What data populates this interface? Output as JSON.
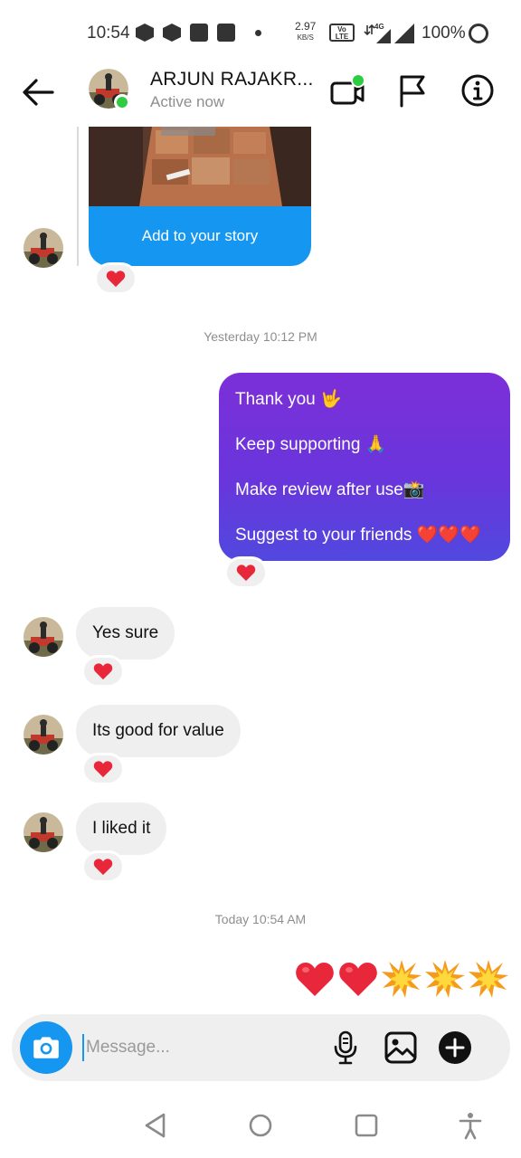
{
  "status_bar": {
    "time": "10:54",
    "net_speed": "2.97",
    "net_speed_unit": "KB/S",
    "volte_top": "Vo",
    "volte_bottom": "LTE",
    "network_type": "4G",
    "battery": "100%"
  },
  "header": {
    "contact_name": "ARJUN RAJAKR...",
    "contact_status": "Active now"
  },
  "story": {
    "button_label": "Add to your story"
  },
  "timestamps": {
    "yesterday": "Yesterday 10:12 PM",
    "today": "Today 10:54 AM"
  },
  "outgoing": {
    "lines": [
      "Thank you 🤟",
      "Keep supporting 🙏",
      "Make review after use📸",
      "Suggest to your friends ❤️❤️❤️"
    ]
  },
  "incoming": [
    "Yes sure",
    "Its good for value",
    "I liked it"
  ],
  "emoji_message": [
    "heart",
    "heart",
    "collision",
    "collision",
    "collision"
  ],
  "composer": {
    "placeholder": "Message..."
  },
  "colors": {
    "accent_blue": "#1596f0",
    "bubble_purple_top": "#7c2fd8",
    "bubble_purple_bottom": "#5148de",
    "bubble_gray": "#efefef",
    "online_green": "#2ecc40",
    "heart_red": "#e8283a"
  },
  "icons": [
    "back-arrow-icon",
    "video-call-icon",
    "flag-icon",
    "info-icon",
    "camera-icon",
    "microphone-icon",
    "gallery-icon",
    "plus-icon",
    "nav-back-icon",
    "nav-home-icon",
    "nav-recents-icon",
    "accessibility-icon"
  ]
}
